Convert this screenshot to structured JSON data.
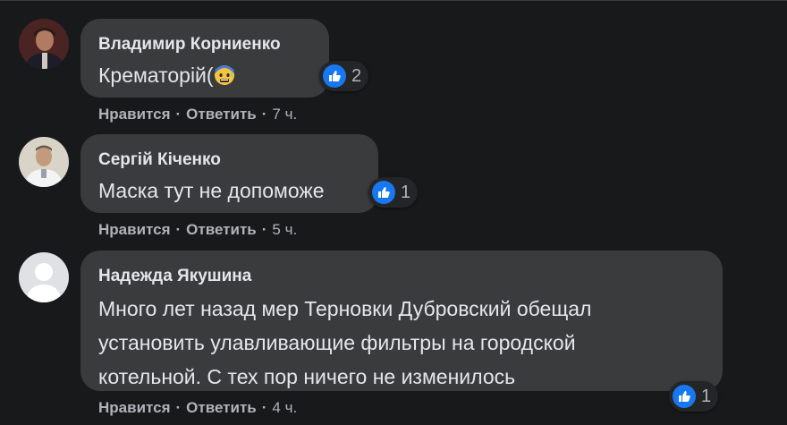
{
  "colors": {
    "background": "#18191a",
    "bubble": "#3a3b3c",
    "text": "#e4e6eb",
    "meta": "#b0b3b8",
    "like": "#1877f2"
  },
  "comments": [
    {
      "author": "Владимир Корниенко",
      "text": "Крематорій(",
      "emoji_icon": "anxious-sweat-face-emoji",
      "reaction_icon": "like-icon",
      "reaction_count": "2",
      "like_label": "Нравится",
      "reply_label": "Ответить",
      "separator": "·",
      "time": "7 ч."
    },
    {
      "author": "Сергій Кіченко",
      "text": "Маска тут не допоможе",
      "reaction_icon": "like-icon",
      "reaction_count": "1",
      "like_label": "Нравится",
      "reply_label": "Ответить",
      "separator": "·",
      "time": "5 ч."
    },
    {
      "author": "Надежда Якушина",
      "text_lines": [
        "Много лет назад мер Терновки Дубровский обещал",
        "установить улавливающие фильтры на городской",
        "котельной. С тех пор ничего не изменилось"
      ],
      "reaction_icon": "like-icon",
      "reaction_count": "1",
      "like_label": "Нравится",
      "reply_label": "Ответить",
      "separator": "·",
      "time": "4 ч."
    }
  ]
}
